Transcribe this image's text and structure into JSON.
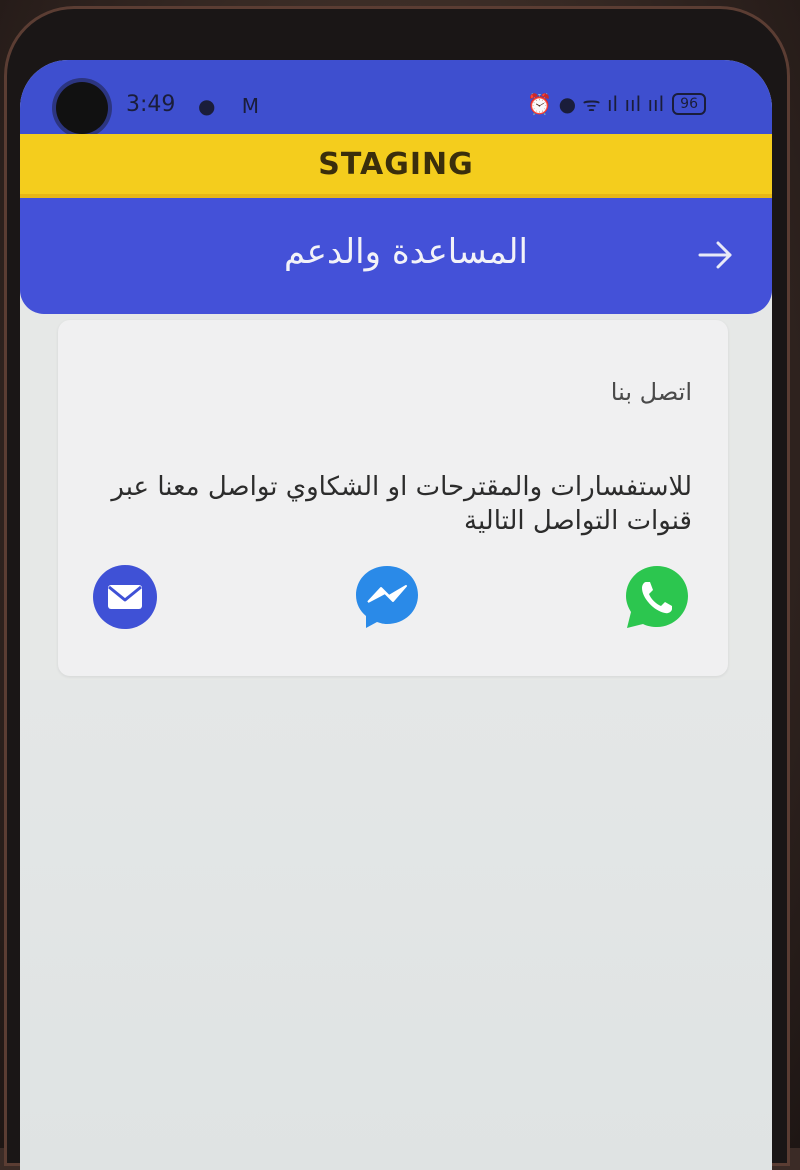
{
  "status_bar": {
    "time": "3:49",
    "left_icons": [
      "chat-bubble-icon",
      "gmail-icon"
    ],
    "right_icons": [
      "alarm-icon",
      "location-icon",
      "wifi-icon",
      "volte-icon",
      "signal-icon",
      "signal-icon"
    ],
    "left_glyphs": "● M",
    "right_glyphs": "⏰ ● ᯤ ıl ııl ııl",
    "battery": "96"
  },
  "banner": {
    "label": "STAGING"
  },
  "app_bar": {
    "title": "المساعدة والدعم"
  },
  "card": {
    "title": "اتصل بنا",
    "body": "للاستفسارات والمقترحات او الشكاوي تواصل معنا عبر قنوات التواصل التالية",
    "channels": [
      {
        "name": "email",
        "icon": "email-icon",
        "color": "#3f51d6"
      },
      {
        "name": "messenger",
        "icon": "messenger-icon",
        "color": "#2a8ae8"
      },
      {
        "name": "whatsapp",
        "icon": "whatsapp-icon",
        "color": "#2cc64f"
      }
    ]
  },
  "colors": {
    "primary": "#4451d8",
    "staging": "#f4cd1d",
    "background": "#e6e8e7"
  }
}
